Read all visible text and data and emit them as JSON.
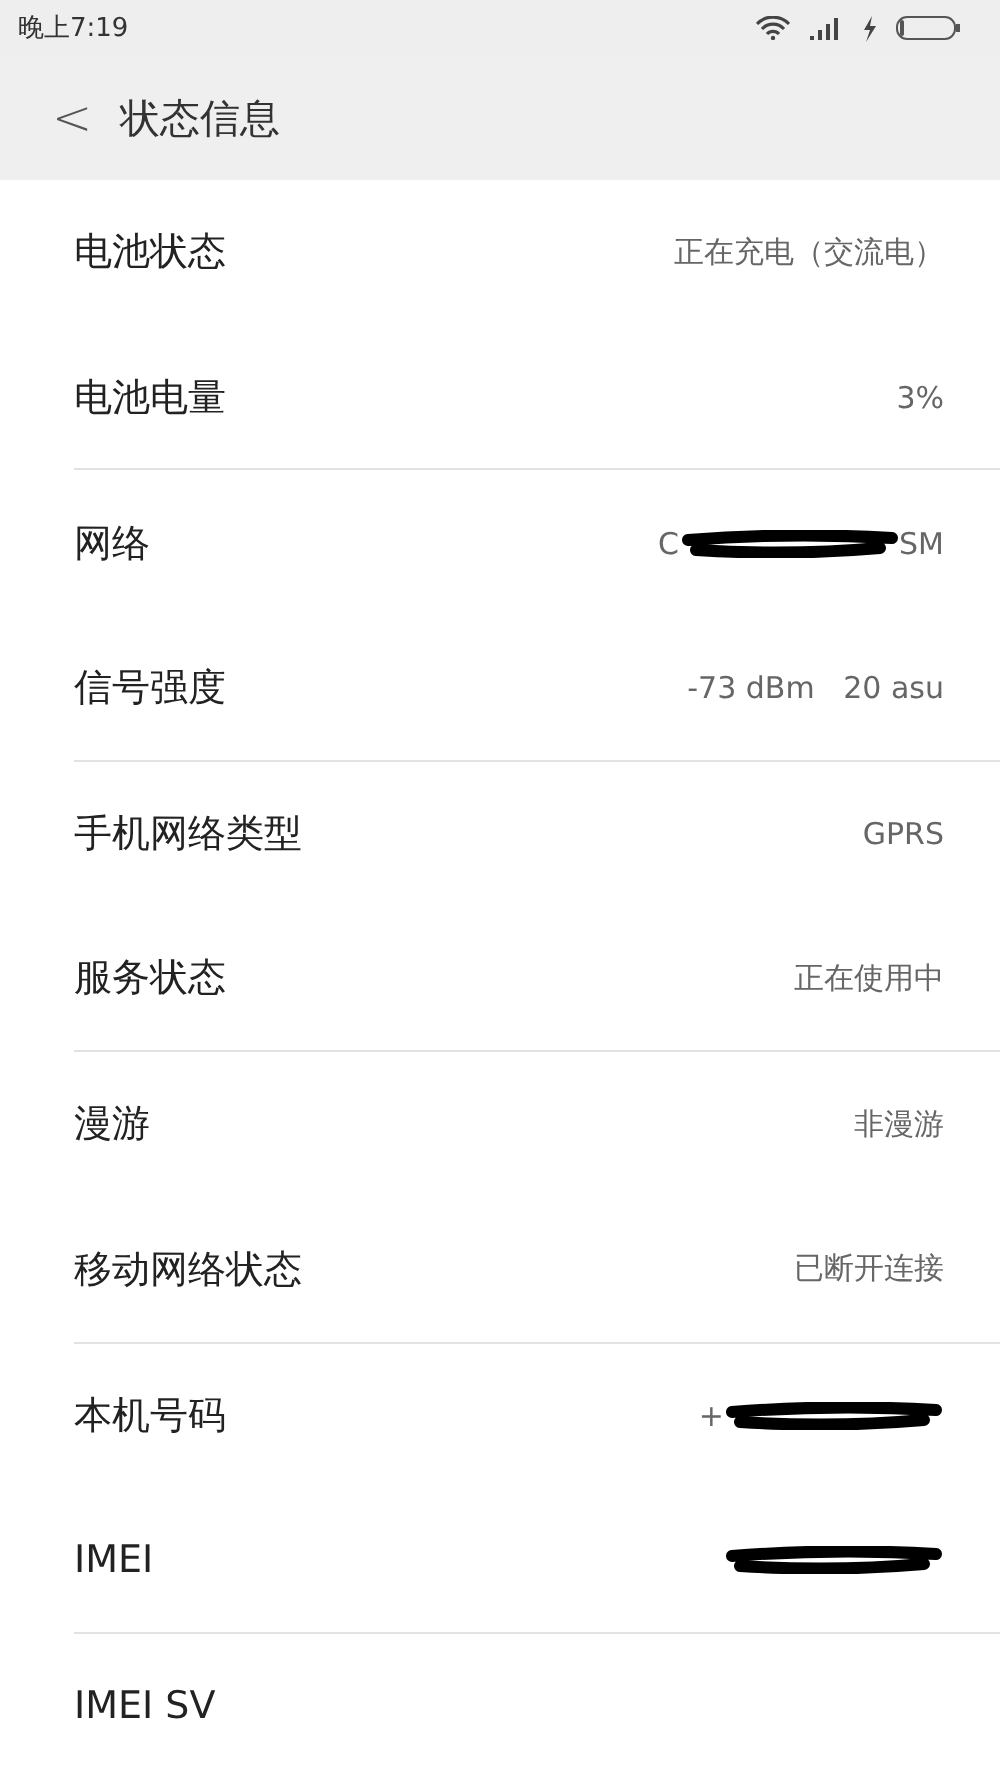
{
  "status_bar": {
    "time": "晚上7:19",
    "charging": true
  },
  "header": {
    "back": "<",
    "title": "状态信息"
  },
  "rows": [
    {
      "label": "电池状态",
      "value": "正在充电（交流电）",
      "divider": false
    },
    {
      "label": "电池电量",
      "value": "3%",
      "divider": true
    },
    {
      "label": "网络",
      "value": "C",
      "value_end": "SM",
      "redacted": true,
      "divider": false
    },
    {
      "label": "信号强度",
      "value": "-73 dBm   20 asu",
      "divider": true
    },
    {
      "label": "手机网络类型",
      "value": "GPRS",
      "divider": false
    },
    {
      "label": "服务状态",
      "value": "正在使用中",
      "divider": true
    },
    {
      "label": "漫游",
      "value": "非漫游",
      "divider": false
    },
    {
      "label": "移动网络状态",
      "value": "已断开连接",
      "divider": true
    },
    {
      "label": "本机号码",
      "value": "+",
      "redacted": true,
      "divider": false
    },
    {
      "label": "IMEI",
      "redacted": true,
      "divider": true
    },
    {
      "label": "IMEI SV"
    }
  ]
}
